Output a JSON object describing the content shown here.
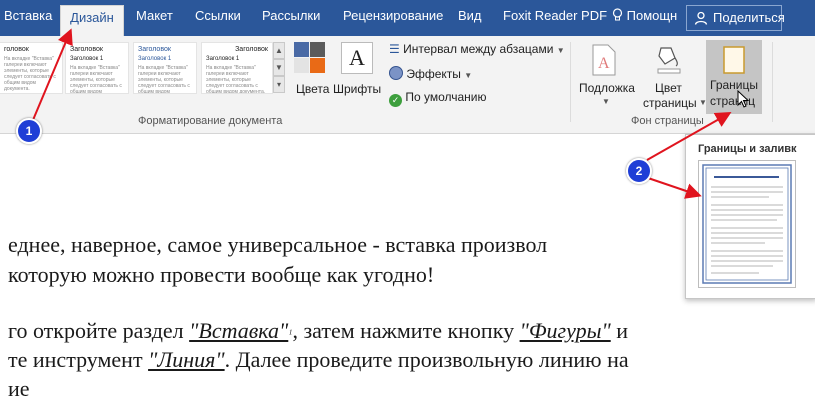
{
  "tabs": {
    "insert": "Вставка",
    "design": "Дизайн",
    "layout": "Макет",
    "references": "Ссылки",
    "mailings": "Рассылки",
    "review": "Рецензирование",
    "view": "Вид",
    "foxit": "Foxit Reader PDF",
    "help": "Помощн",
    "share": "Поделиться"
  },
  "ribbon": {
    "gallery": {
      "thumb1_heading": "головок",
      "thumb2_heading": "Заголовок",
      "thumb2_sub": "Заголовок 1",
      "thumb3_heading": "Заголовок",
      "thumb3_sub": "Заголовок 1",
      "thumb4_heading": "Заголовок",
      "thumb4_sub": "Заголовок 1",
      "body_text": "На вкладке \"Вставка\" галереи включают элементы, которые следует согласовать с общим видом документа."
    },
    "colors_label": "Цвета",
    "fonts_label": "Шрифты",
    "paragraph_spacing_label": "Интервал между абзацами",
    "effects_label": "Эффекты",
    "default_label": "По умолчанию",
    "group_document_formatting": "Форматирование документа",
    "watermark_label": "Подложка",
    "page_color_label_1": "Цвет",
    "page_color_label_2": "страницы",
    "page_borders_label_1": "Границы",
    "page_borders_label_2": "страниц",
    "group_page_background": "Фон страницы"
  },
  "document": {
    "line1": "еднее, наверное, самое универсальное - вставка произвол",
    "line2": "которую можно провести вообще как угодно!",
    "line3_a": "го откройте раздел ",
    "line3_link": "\"Вставка\"",
    "line3_sup": "₁",
    "line3_b": ", затем нажмите кнопку ",
    "line3_link2": "\"Фигуры\"",
    "line3_c": " и",
    "line4_a": "те инструмент ",
    "line4_link": "\"Линия\"",
    "line4_b": ". Далее проведите произвольную линию на",
    "line5": "ие"
  },
  "dropdown": {
    "title": "Границы и заливк",
    "preview_heading": "TechVision Business Plan Update"
  },
  "markers": {
    "m1": "1",
    "m2": "2"
  },
  "colors": {
    "ribbon_blue": "#2b579a",
    "marker_blue": "#1f3ed6",
    "arrow_red": "#e0141e"
  }
}
